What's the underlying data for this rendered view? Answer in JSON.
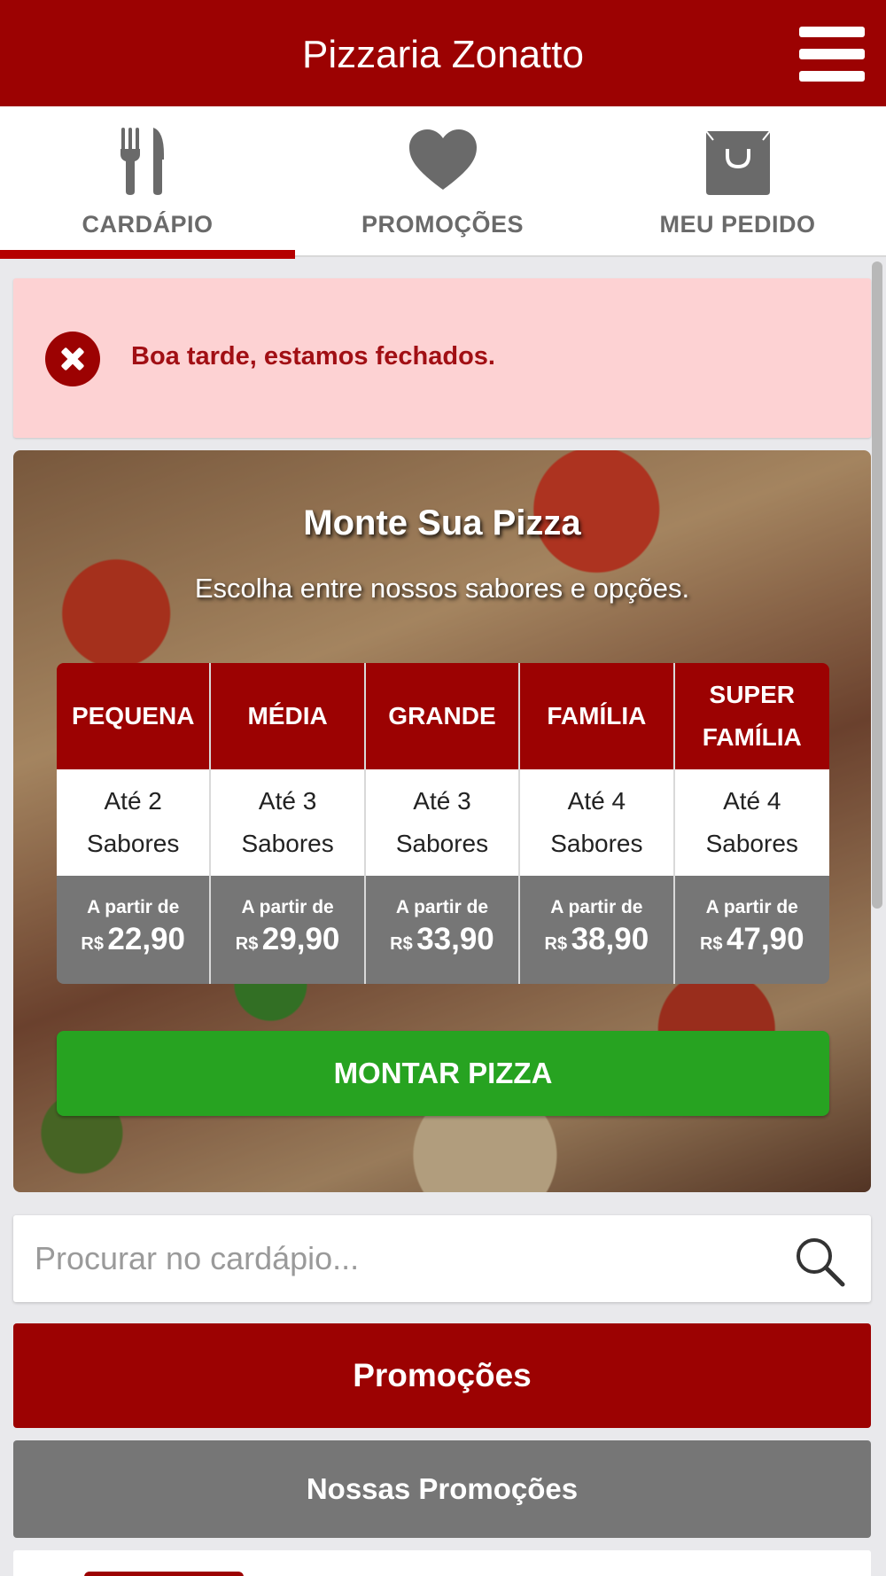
{
  "header": {
    "title": "Pizzaria Zonatto",
    "menu_icon": "hamburger-menu-icon"
  },
  "tabs": [
    {
      "label": "CARDÁPIO",
      "icon": "fork-knife-icon",
      "active": true
    },
    {
      "label": "PROMOÇÕES",
      "icon": "heart-icon",
      "active": false
    },
    {
      "label": "MEU PEDIDO",
      "icon": "shopping-bag-icon",
      "active": false
    }
  ],
  "alert": {
    "message": "Boa tarde, estamos fechados.",
    "icon": "close-circle-icon"
  },
  "builder": {
    "title": "Monte Sua Pizza",
    "subtitle": "Escolha entre nossos sabores e opções.",
    "sizes": [
      {
        "name": "PEQUENA",
        "flavors": "Até 2 Sabores",
        "from": "A partir de",
        "currency": "R$",
        "price": "22,90"
      },
      {
        "name": "MÉDIA",
        "flavors": "Até 3 Sabores",
        "from": "A partir de",
        "currency": "R$",
        "price": "29,90"
      },
      {
        "name": "GRANDE",
        "flavors": "Até 3 Sabores",
        "from": "A partir de",
        "currency": "R$",
        "price": "33,90"
      },
      {
        "name": "FAMÍLIA",
        "flavors": "Até 4 Sabores",
        "from": "A partir de",
        "currency": "R$",
        "price": "38,90"
      },
      {
        "name": "SUPER FAMÍLIA",
        "flavors": "Até 4 Sabores",
        "from": "A partir de",
        "currency": "R$",
        "price": "47,90"
      }
    ],
    "button_label": "MONTAR PIZZA"
  },
  "search": {
    "placeholder": "Procurar no cardápio...",
    "value": "",
    "icon": "search-icon"
  },
  "sections": {
    "promo_title": "Promoções",
    "nossas_title": "Nossas Promoções"
  },
  "colors": {
    "brand_red": "#9c0202",
    "green": "#27a321",
    "gray": "#767676",
    "alert_bg": "#fdd2d3"
  }
}
